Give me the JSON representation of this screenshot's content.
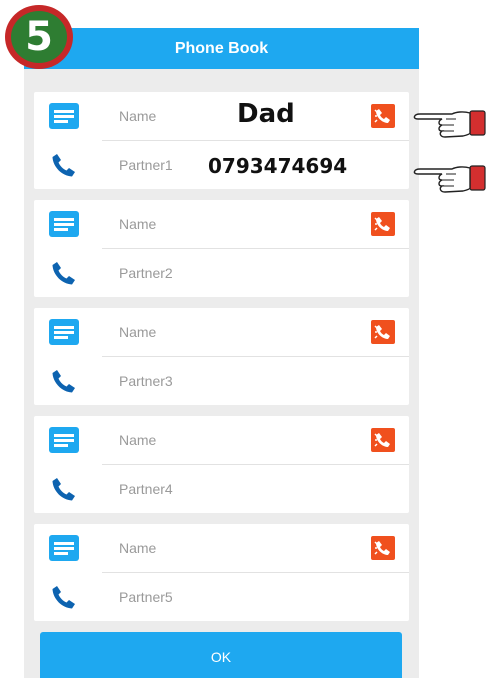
{
  "step_badge": "5",
  "title": "Phone Book",
  "entries": [
    {
      "name_placeholder": "Name",
      "number_placeholder": "Partner1"
    },
    {
      "name_placeholder": "Name",
      "number_placeholder": "Partner2"
    },
    {
      "name_placeholder": "Name",
      "number_placeholder": "Partner3"
    },
    {
      "name_placeholder": "Name",
      "number_placeholder": "Partner4"
    },
    {
      "name_placeholder": "Name",
      "number_placeholder": "Partner5"
    }
  ],
  "annotation": {
    "name_value": "Dad",
    "number_value": "0793474694"
  },
  "ok_label": "OK",
  "colors": {
    "accent": "#1ea8f0",
    "call": "#f0501e",
    "badge_green": "#2e7d32",
    "badge_red": "#c62828",
    "hand_cuff": "#d32f2f"
  },
  "icons": {
    "contact": "contact-card-icon",
    "phone": "phone-icon",
    "call": "call-handset-icon",
    "pointer": "pointing-hand-icon"
  }
}
